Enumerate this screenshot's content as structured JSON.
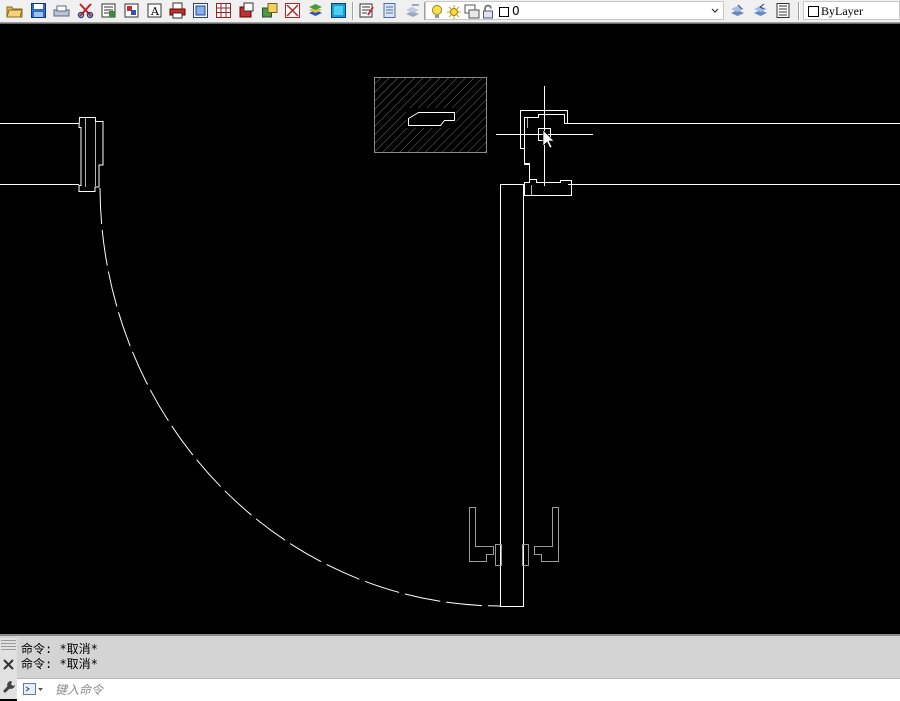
{
  "toolbar": {
    "buttons": [
      {
        "icon": "open-folder-icon"
      },
      {
        "icon": "save-icon"
      },
      {
        "icon": "plot-icon"
      },
      {
        "icon": "cut-icon"
      },
      {
        "icon": "match-properties-icon"
      },
      {
        "icon": "block-icon"
      },
      {
        "icon": "text-style-icon"
      },
      {
        "icon": "print-icon"
      },
      {
        "icon": "viewport-icon"
      },
      {
        "icon": "table-icon"
      },
      {
        "icon": "insert-block-icon"
      },
      {
        "icon": "xref-icon"
      },
      {
        "icon": "region-icon"
      },
      {
        "icon": "layer-states-icon"
      },
      {
        "icon": "image-icon"
      },
      {
        "icon": "properties-icon"
      },
      {
        "icon": "design-center-icon"
      },
      {
        "icon": "tool-palette-icon"
      }
    ],
    "layer": {
      "current": "0",
      "icons": [
        "lightbulb-icon",
        "sun-icon",
        "viewport-freeze-icon",
        "lock-icon",
        "layer-color-icon"
      ]
    },
    "layer_tools": [
      {
        "icon": "make-current-icon"
      },
      {
        "icon": "layer-previous-icon"
      },
      {
        "icon": "layer-manager-icon"
      }
    ],
    "color": {
      "current": "ByLayer",
      "swatch": "#ffffff"
    }
  },
  "canvas": {
    "background": "#000000",
    "line_color": "#ffffff"
  },
  "command": {
    "history": [
      "命令: *取消*",
      "命令: *取消*"
    ],
    "placeholder": "键入命令"
  }
}
